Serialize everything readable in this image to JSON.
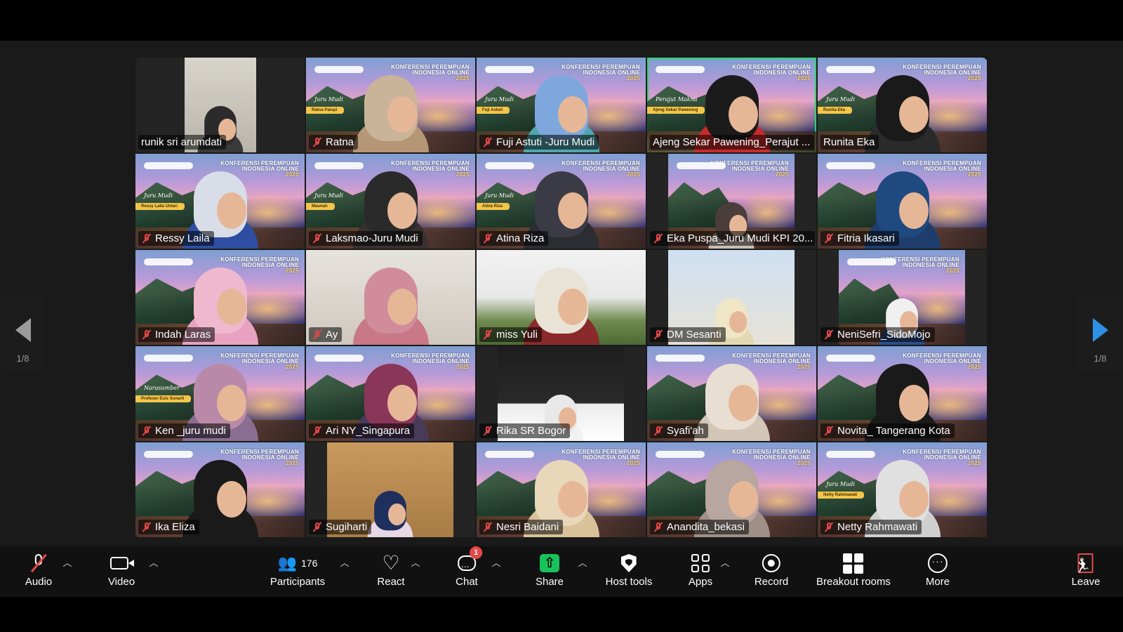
{
  "navigation": {
    "page_indicator_left": "1/8",
    "page_indicator_right": "1/8"
  },
  "conference_banner": {
    "line1": "KONFERENSI PEREMPUAN",
    "line2": "INDONESIA ONLINE",
    "year": "2025"
  },
  "tiles": [
    {
      "name": "runik sri arumdati",
      "muted": false,
      "bg": "room",
      "inset": true,
      "hijab": "#2b2b2b",
      "body": "#3a3a3a",
      "active": false
    },
    {
      "name": "Ratna",
      "muted": true,
      "bg": "conf",
      "hijab": "#c9b49a",
      "body": "#b59776",
      "script": "Juru Mudi",
      "badge": "Ratna Palupi"
    },
    {
      "name": "Fuji Astuti -Juru Mudi",
      "muted": true,
      "bg": "conf",
      "hijab": "#7ea8dd",
      "body": "#4fa7b0",
      "script": "Juru Mudi",
      "badge": "Fuji Astuti"
    },
    {
      "name": "Ajeng Sekar Pawening_Perajut ...",
      "muted": false,
      "bg": "conf",
      "hijab": "#1b1b1b",
      "body": "#c92b2b",
      "script": "Perajut Makna",
      "badge": "Ajeng Sekar Pawening",
      "active": true
    },
    {
      "name": "Runita Eka",
      "muted": false,
      "bg": "conf",
      "hijab": "#1a1a1a",
      "body": "#2a2a2a",
      "script": "Juru Mudi",
      "badge": "Runita Eka"
    },
    {
      "name": "Ressy Laila",
      "muted": true,
      "bg": "conf",
      "hijab": "#d8dde8",
      "body": "#2d4ea2",
      "script": "Juru Mudi",
      "badge": "Ressy Laila Untari"
    },
    {
      "name": "Laksmao-Juru Mudi",
      "muted": true,
      "bg": "conf",
      "hijab": "#2a2a2a",
      "body": "#3a3030",
      "script": "Juru Mudi",
      "badge": "Maunah"
    },
    {
      "name": "Atina Riza",
      "muted": true,
      "bg": "conf",
      "hijab": "#3b3b45",
      "body": "#2c2c33",
      "script": "Juru Mudi",
      "badge": "Atina Riza"
    },
    {
      "name": "Eka Puspa_Juru Mudi KPI 20...",
      "muted": true,
      "bg": "conf",
      "inset": true,
      "hijab": "#4a3d3a",
      "body": "#c8c0b6"
    },
    {
      "name": "Fitria Ikasari",
      "muted": true,
      "bg": "conf",
      "hijab": "#1f4a80",
      "body": "#1e3d6d"
    },
    {
      "name": "Indah Laras",
      "muted": true,
      "bg": "conf",
      "hijab": "#f0b8cf",
      "body": "#e8a2c0"
    },
    {
      "name": "Ay",
      "muted": true,
      "bg": "lightroom",
      "hijab": "#d08c9a",
      "body": "#c87888"
    },
    {
      "name": "miss Yuli",
      "muted": true,
      "bg": "house",
      "hijab": "#e9e3d5",
      "body": "#8a2a2a"
    },
    {
      "name": "DM Sesanti",
      "muted": true,
      "bg": "wall",
      "inset": true,
      "hijab": "#efe6c6",
      "body": "#e2d8b3"
    },
    {
      "name": "NeniSefri_SidoMojo",
      "muted": true,
      "bg": "conf",
      "inset": true,
      "hijab": "#f0f0f0",
      "body": "#2b4e8a"
    },
    {
      "name": "Ken _juru mudi",
      "muted": true,
      "bg": "conf",
      "hijab": "#b98aa8",
      "body": "#8a6d90",
      "script": "Narasumber",
      "badge": "Profesor Euis Sunarti"
    },
    {
      "name": "Ari NY_Singapura",
      "muted": true,
      "bg": "conf",
      "hijab": "#8a3658",
      "body": "#4a3a5a"
    },
    {
      "name": "Rika SR Bogor",
      "muted": true,
      "bg": "car",
      "inset": true,
      "hijab": "#e8e8e8",
      "body": "#f2f2f2"
    },
    {
      "name": "Syafi'ah",
      "muted": true,
      "bg": "conf",
      "hijab": "#e8ded2",
      "body": "#d2c6b6"
    },
    {
      "name": "Novita_ Tangerang Kota",
      "muted": true,
      "bg": "conf",
      "hijab": "#1a1a1a",
      "body": "#1a1a1a"
    },
    {
      "name": "Ika Eliza",
      "muted": true,
      "bg": "conf",
      "hijab": "#1a1a1a",
      "body": "#1a1a1a"
    },
    {
      "name": "Sugiharti",
      "muted": true,
      "bg": "door",
      "inset": true,
      "hijab": "#1f2f5e",
      "body": "#e7d8e6"
    },
    {
      "name": "Nesri Baidani",
      "muted": true,
      "bg": "conf",
      "hijab": "#e9d7b9",
      "body": "#d9c29a"
    },
    {
      "name": "Anandita_bekasi",
      "muted": true,
      "bg": "conf",
      "hijab": "#b8a6a0",
      "body": "#a09088"
    },
    {
      "name": "Netty Rahmawati",
      "muted": true,
      "bg": "conf",
      "hijab": "#e0e0e0",
      "body": "#cfcfcf",
      "script": "Juru Mudi",
      "badge": "Netty Rahmawati"
    }
  ],
  "toolbar": {
    "audio": "Audio",
    "video": "Video",
    "participants": "Participants",
    "participants_count": "176",
    "react": "React",
    "chat": "Chat",
    "chat_badge": "1",
    "share": "Share",
    "host_tools": "Host tools",
    "apps": "Apps",
    "record": "Record",
    "breakout_rooms": "Breakout rooms",
    "more": "More",
    "leave": "Leave"
  },
  "colors": {
    "active_speaker": "#23d96b",
    "muted_mic": "#e64848",
    "share_green": "#19c25b",
    "nav_arrow": "#2f8fe6"
  }
}
